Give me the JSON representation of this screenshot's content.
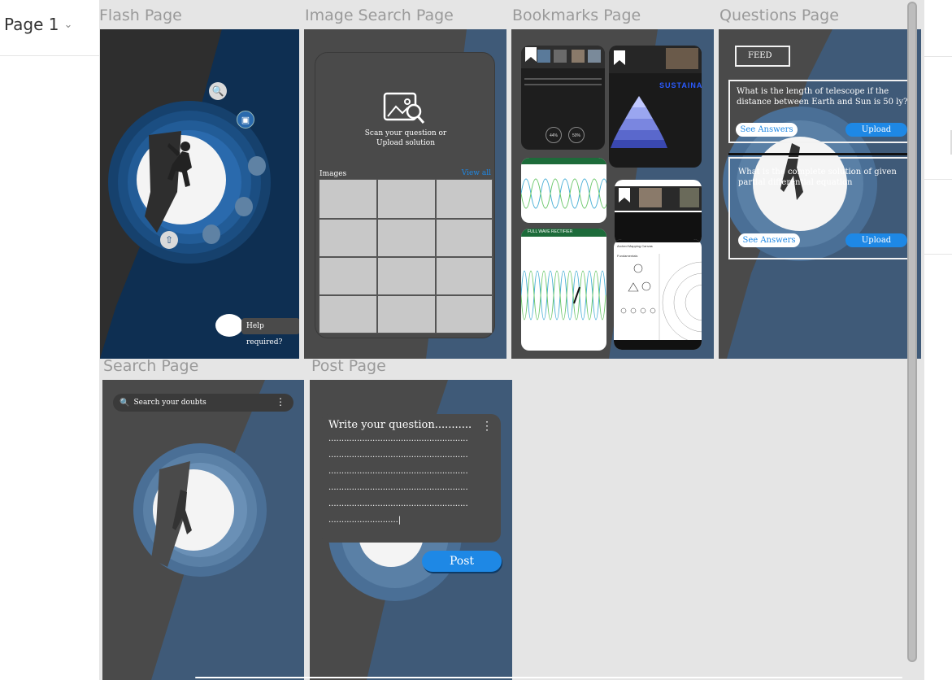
{
  "sidebar": {
    "page_label": "Page 1"
  },
  "frames": {
    "flash": {
      "label": "Flash Page",
      "help_text": "Help required?"
    },
    "image_search": {
      "label": "Image Search Page",
      "scan_text_1": "Scan your question or",
      "scan_text_2": "Upload solution",
      "images_label": "Images",
      "view_all": "View all"
    },
    "bookmarks": {
      "label": "Bookmarks Page",
      "sustain_text": "SUSTAINA",
      "rectifier_text": "FULL WAVE RECTIFIER",
      "mapping_text": "Arched Mapping Canvas",
      "fundamentals_text": "Fundamentals",
      "percent_1": "44%",
      "percent_2": "50%"
    },
    "questions": {
      "label": "Questions Page",
      "feed_label": "FEED",
      "q1_text": "What is the length of telescope if the distance between Earth and Sun is 50 ly?",
      "q2_text": "What is the complete solution of given partial differential equation",
      "see_answers": "See Answers",
      "upload": "Upload"
    },
    "search": {
      "label": "Search Page",
      "placeholder": "Search your doubts"
    },
    "post": {
      "label": "Post Page",
      "lines": [
        "Write your question...........",
        "......................................................",
        "......................................................",
        "......................................................",
        "......................................................",
        "......................................................",
        "...........................|"
      ],
      "post_button": "Post"
    }
  },
  "colors": {
    "canvas": "#e5e5e5",
    "dark_rock": "#4a4a4a",
    "deep_blue": "#0e2f52",
    "slate_blue": "#3f5a78",
    "moon": "#f4f4f4",
    "accent_blue": "#1e88e5"
  }
}
